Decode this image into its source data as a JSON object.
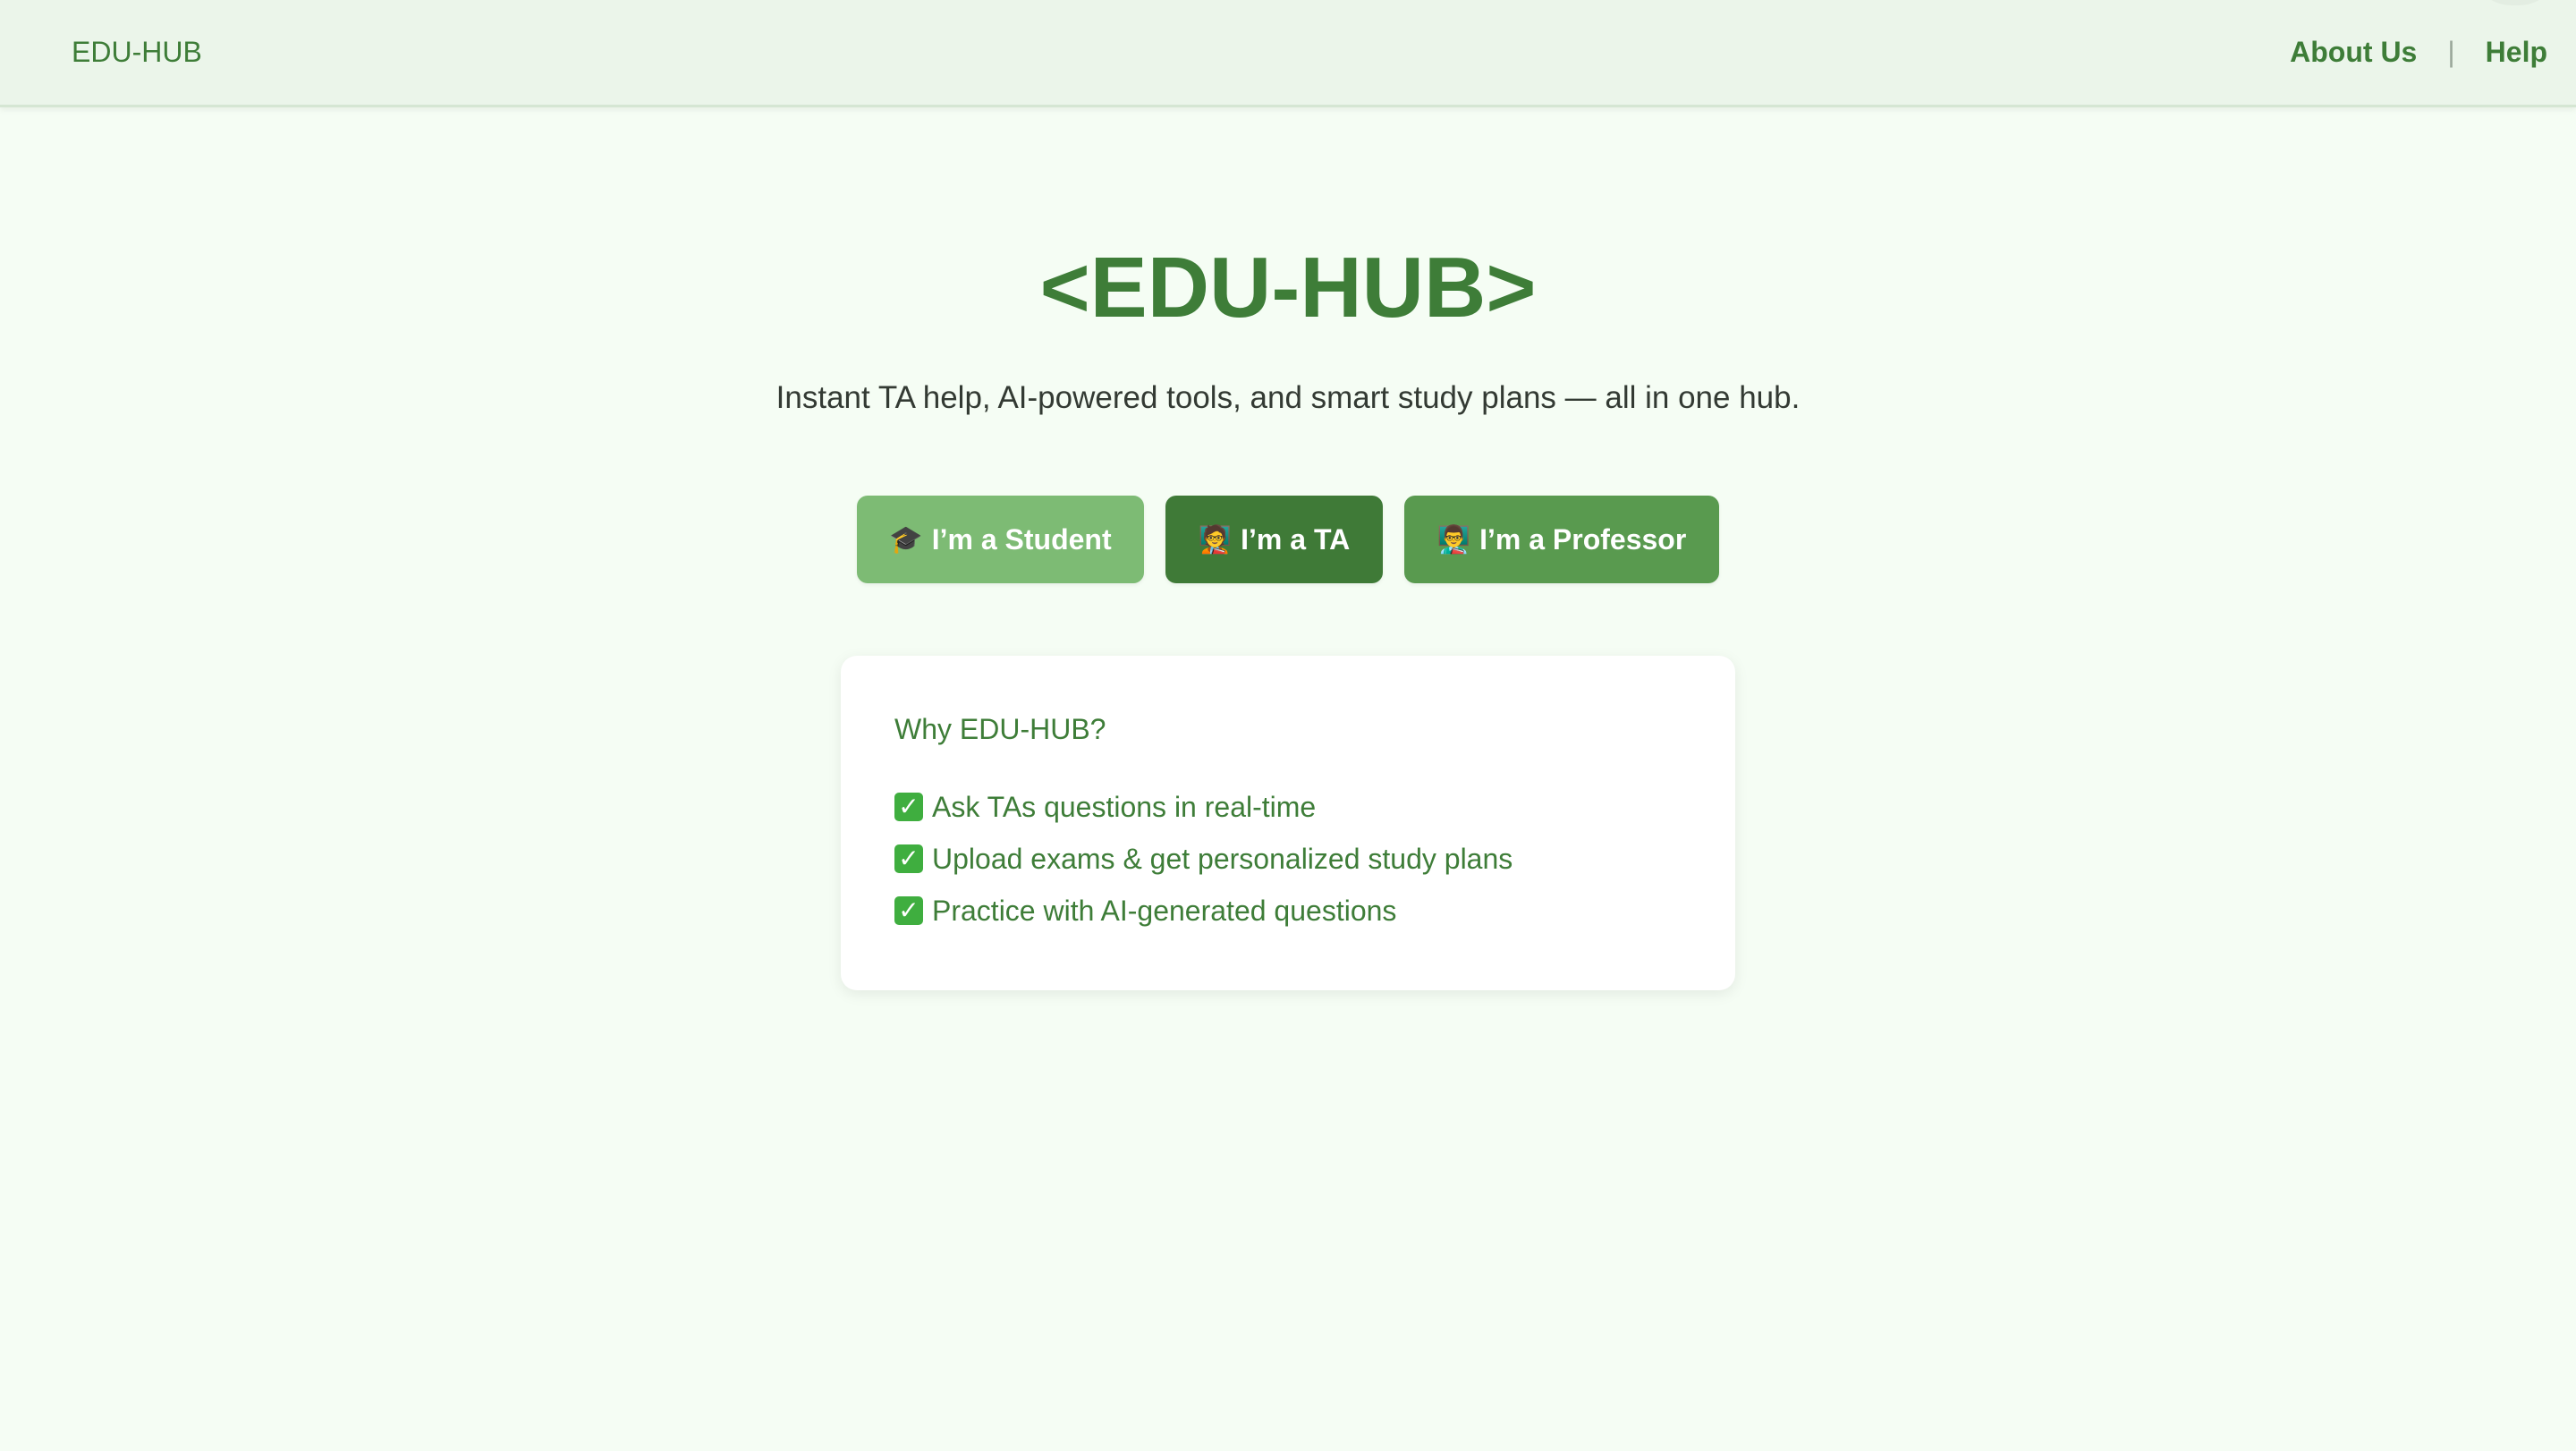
{
  "header": {
    "brand": "EDU-HUB",
    "nav": {
      "about": "About Us",
      "separator": "|",
      "help": "Help"
    }
  },
  "hero": {
    "title": "<EDU-HUB>",
    "subtitle": "Instant TA help, AI-powered tools, and smart study plans — all in one hub."
  },
  "roles": [
    {
      "icon": "graduation-cap-icon",
      "emoji": "🎓",
      "label": "I’m a Student",
      "color": "#7dbb74"
    },
    {
      "icon": "teacher-icon",
      "emoji": "🧑‍🏫",
      "label": "I’m a TA",
      "color": "#3f7a37"
    },
    {
      "icon": "professor-icon",
      "emoji": "👨‍🏫",
      "label": "I’m a Professor",
      "color": "#599a4f"
    }
  ],
  "why": {
    "title": "Why EDU-HUB?",
    "check_icon": "check-mark-icon",
    "check_glyph": "✓",
    "items": [
      "Ask TAs questions in real-time",
      "Upload exams & get personalized study plans",
      "Practice with AI-generated questions"
    ]
  },
  "colors": {
    "brand_green": "#3e7d38",
    "header_bg": "#ebf5ea",
    "page_bg": "#f5fdf4"
  }
}
